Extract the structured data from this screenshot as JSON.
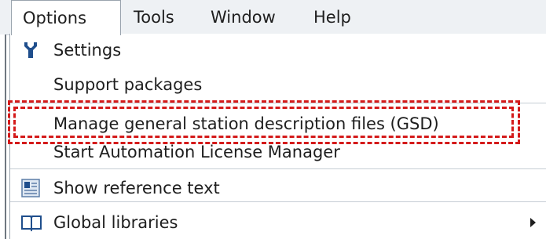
{
  "menubar": {
    "items": [
      {
        "label": "Options"
      },
      {
        "label": "Tools"
      },
      {
        "label": "Window"
      },
      {
        "label": "Help"
      }
    ]
  },
  "menu": {
    "items": [
      {
        "label": "Settings",
        "icon": "wrench-icon"
      },
      {
        "label": "Support packages"
      },
      {
        "label": "Manage general station description files (GSD)"
      },
      {
        "label": "Start Automation License Manager"
      },
      {
        "label": "Show reference text",
        "icon": "reference-text-icon"
      },
      {
        "label": "Global libraries",
        "icon": "book-icon",
        "has_submenu": true
      }
    ]
  },
  "colors": {
    "highlight": "#d41a1a",
    "menubar_bg": "#eef1f4",
    "icon_blue": "#1f4e8c"
  }
}
